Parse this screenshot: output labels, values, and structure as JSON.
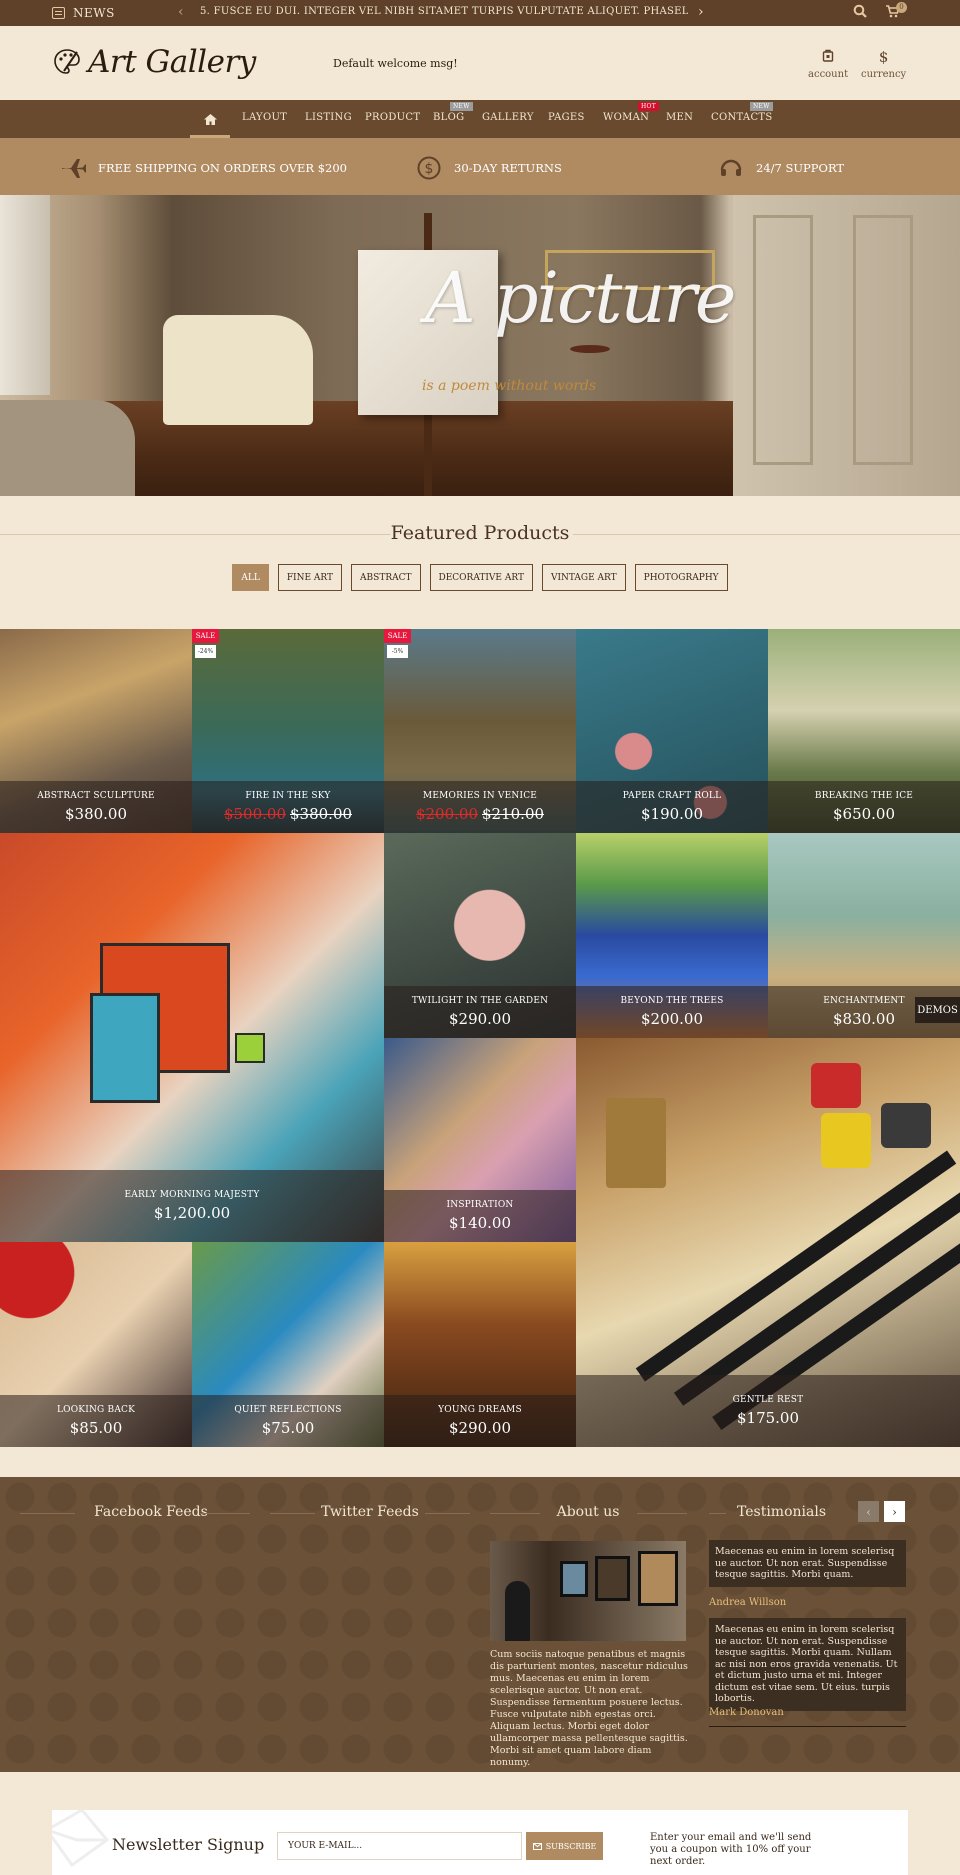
{
  "topbar": {
    "news_label": "NEWS",
    "ticker": "5. FUSCE EU DUI. INTEGER VEL NIBH SITAMET TURPIS VULPUTATE ALIQUET. PHASELLUS ID NISI VITAE ODIO I",
    "cart_count": "0"
  },
  "header": {
    "logo": "Art Gallery",
    "welcome": "Default welcome msg!",
    "account": "account",
    "currency": "currency"
  },
  "nav": [
    {
      "label": "LAYOUT"
    },
    {
      "label": "LISTING"
    },
    {
      "label": "PRODUCT"
    },
    {
      "label": "BLOG",
      "tag": "NEW"
    },
    {
      "label": "GALLERY"
    },
    {
      "label": "PAGES"
    },
    {
      "label": "WOMAN",
      "tag": "HOT"
    },
    {
      "label": "MEN"
    },
    {
      "label": "CONTACTS",
      "tag": "NEW"
    }
  ],
  "services": [
    {
      "label": "FREE SHIPPING ON ORDERS OVER $200",
      "icon": "plane-icon"
    },
    {
      "label": "30-DAY RETURNS",
      "icon": "dollar-coin-icon"
    },
    {
      "label": "24/7 SUPPORT",
      "icon": "headset-icon"
    }
  ],
  "hero": {
    "title": "A picture",
    "subtitle": "is a poem without words"
  },
  "featured": {
    "title": "Featured Products",
    "filters": [
      "ALL",
      "FINE ART",
      "ABSTRACT",
      "DECORATIVE ART",
      "VINTAGE ART",
      "PHOTOGRAPHY"
    ]
  },
  "products": [
    {
      "name": "ABSTRACT SCULPTURE",
      "price": "$380.00"
    },
    {
      "name": "FIRE IN THE SKY",
      "old_price": "$500.00",
      "price": "$380.00",
      "sale": "SALE",
      "discount": "-24%"
    },
    {
      "name": "MEMORIES IN VENICE",
      "old_price": "$200.00",
      "price": "$210.00",
      "sale": "SALE",
      "discount": "-5%"
    },
    {
      "name": "PAPER CRAFT ROLL",
      "price": "$190.00"
    },
    {
      "name": "BREAKING THE ICE",
      "price": "$650.00"
    },
    {
      "name": "EARLY MORNING MAJESTY",
      "price": "$1,200.00"
    },
    {
      "name": "TWILIGHT IN THE GARDEN",
      "price": "$290.00"
    },
    {
      "name": "BEYOND THE TREES",
      "price": "$200.00"
    },
    {
      "name": "ENCHANTMENT",
      "price": "$830.00"
    },
    {
      "name": "INSPIRATION",
      "price": "$140.00"
    },
    {
      "name": "GENTLE REST",
      "price": "$175.00"
    },
    {
      "name": "LOOKING BACK",
      "price": "$85.00"
    },
    {
      "name": "QUIET REFLECTIONS",
      "price": "$75.00"
    },
    {
      "name": "YOUNG DREAMS",
      "price": "$290.00"
    }
  ],
  "demos_label": "DEMOS",
  "widgets": {
    "facebook": "Facebook Feeds",
    "twitter": "Twitter Feeds",
    "about": "About us",
    "testimonials": "Testimonials",
    "about_text": "Cum sociis natoque penatibus et magnis dis parturient montes, nascetur ridiculus mus. Maecenas eu enim in lorem scelerisque auctor. Ut non erat. Suspendisse fermentum posuere lectus. Fusce vulputate nibh egestas orci. Aliquam lectus. Morbi eget dolor ullamcorper massa pellentesque sagittis. Morbi sit amet quam labore diam nonumy.",
    "testimonial_items": [
      {
        "text": "Maecenas eu enim in lorem scelerisq ue auctor. Ut non erat. Suspendisse tesque sagittis. Morbi quam.",
        "author": "Andrea Willson"
      },
      {
        "text": "Maecenas eu enim in lorem scelerisq ue auctor. Ut non erat. Suspendisse tesque sagittis. Morbi quam. Nullam ac nisi non eros gravida venenatis. Ut et dictum justo urna et mi. Integer dictum est vitae sem. Ut eius. turpis lobortis.",
        "author": "Mark Donovan"
      }
    ]
  },
  "newsletter": {
    "title": "Newsletter Signup",
    "placeholder": "YOUR E-MAIL...",
    "button": "SUBSCRIBE",
    "note": "Enter your email and we'll send you a coupon with 10% off your next order."
  },
  "colors": {
    "brown_dark": "#5e4128",
    "brown_nav": "#6a4a2e",
    "tan": "#b08b62",
    "cream": "#f3e8d6",
    "sale_red": "#e6183d"
  }
}
